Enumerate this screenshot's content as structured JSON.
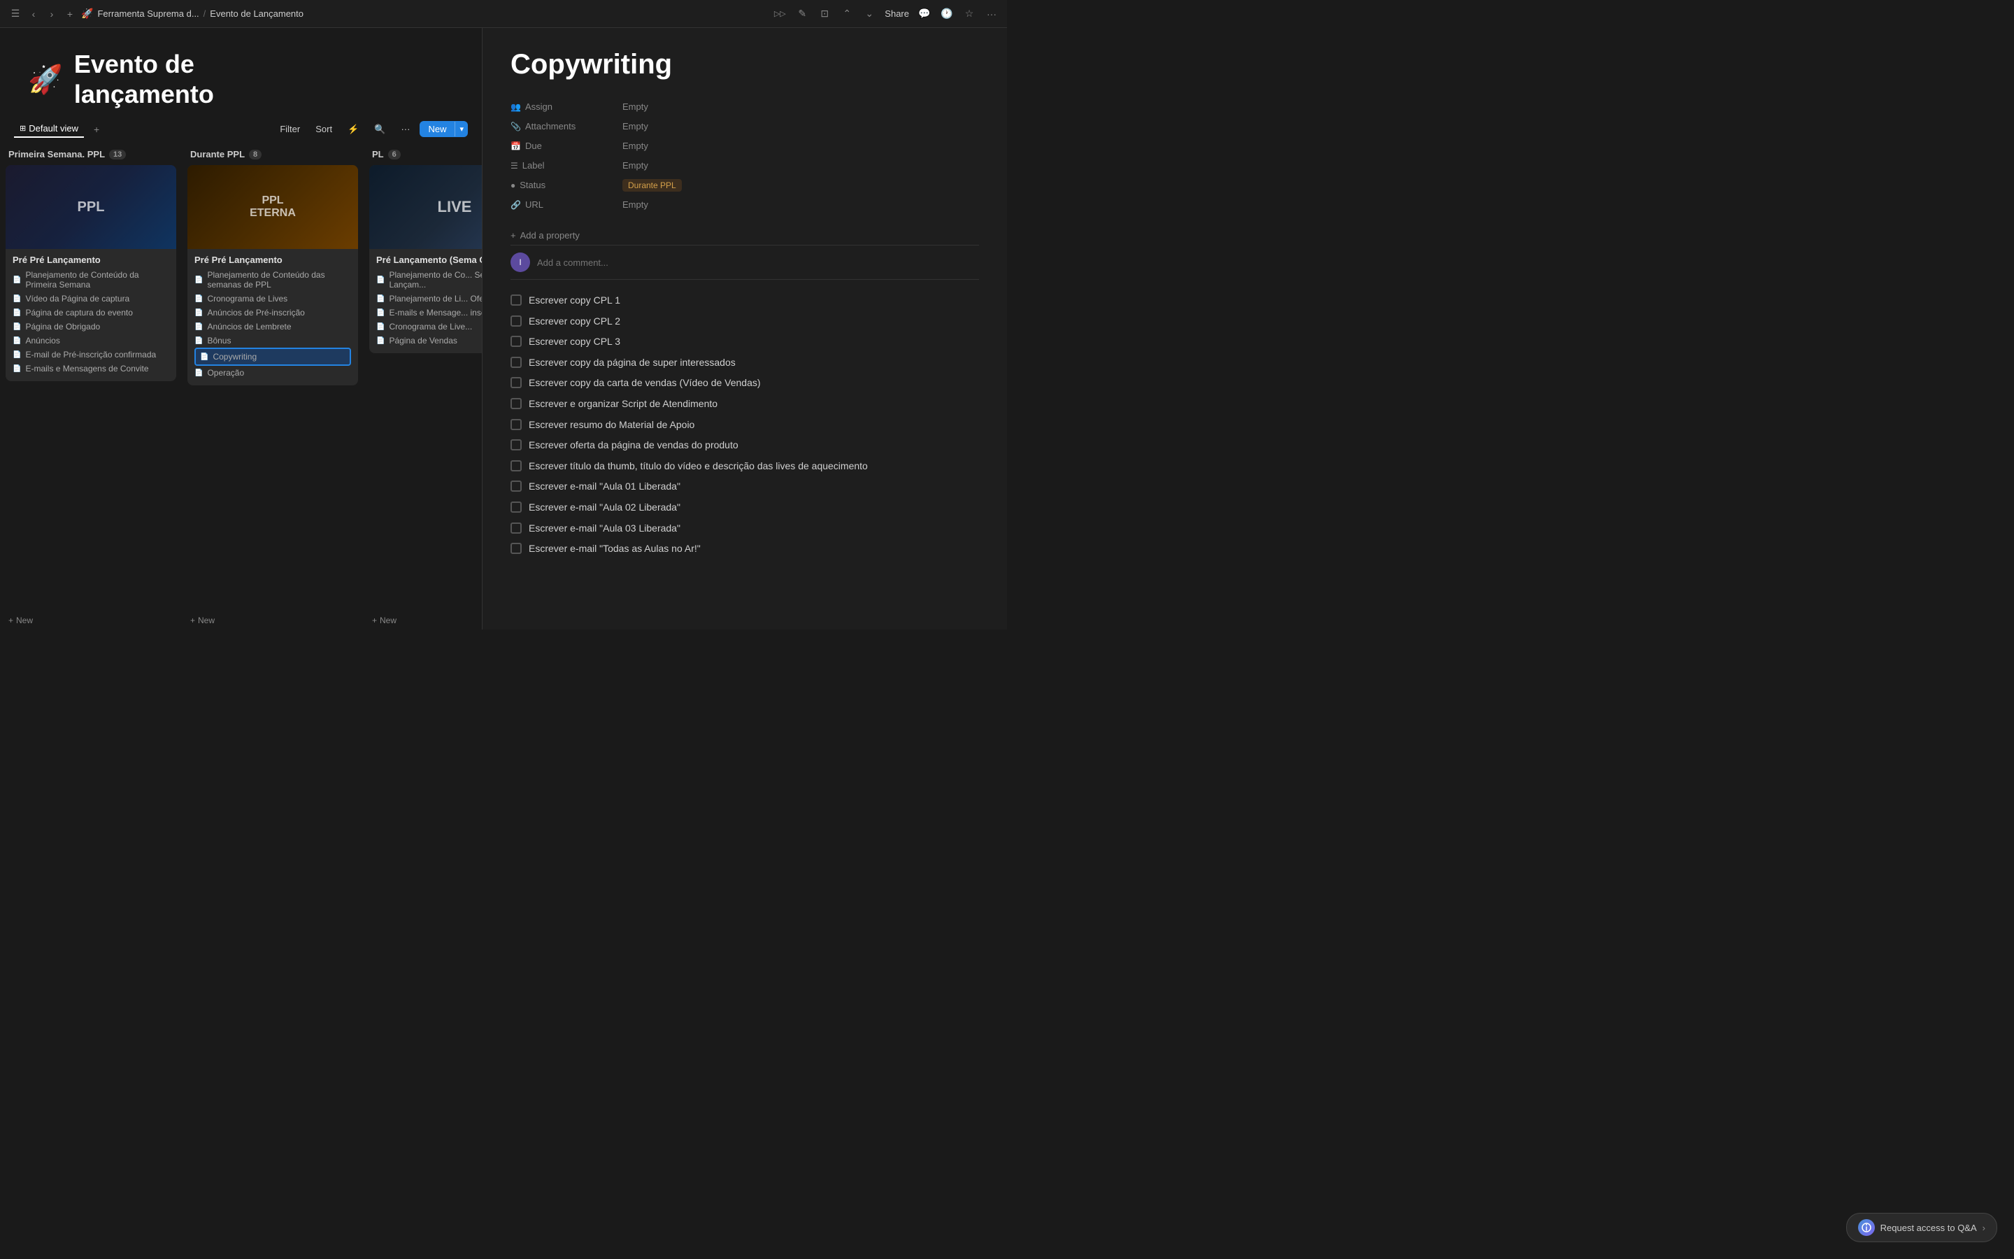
{
  "topbar": {
    "menu_icon": "☰",
    "back_icon": "‹",
    "forward_icon": "›",
    "add_icon": "+",
    "breadcrumb": [
      {
        "label": "Ferramenta Suprema d...",
        "has_icon": true
      },
      {
        "label": "Evento de Lançamento"
      }
    ],
    "right_actions": [
      "Share",
      "💬",
      "🕐",
      "☆",
      "···"
    ],
    "panel_icon": "▷▷"
  },
  "page": {
    "icon": "🚀",
    "title": "Evento de\nlançamento"
  },
  "toolbar": {
    "views": [
      {
        "label": "Default view",
        "icon": "⊞",
        "active": true
      }
    ],
    "add_view_label": "+",
    "filter_label": "Filter",
    "sort_label": "Sort",
    "lightning_icon": "⚡",
    "search_icon": "🔍",
    "more_icon": "···",
    "new_button_label": "New",
    "new_button_arrow": "▾"
  },
  "columns": [
    {
      "id": "col1",
      "label": "Primeira Semana. PPL",
      "count": 13,
      "cards": [
        {
          "id": "card1",
          "has_image": true,
          "image_style": "card-image-1",
          "image_text": "PPL",
          "title": "Pré Pré Lançamento",
          "items": [
            {
              "icon": "📄",
              "label": "Planejamento de Conteúdo da Primeira Semana"
            },
            {
              "icon": "📄",
              "label": "Vídeo da Página de captura"
            },
            {
              "icon": "📄",
              "label": "Página de captura do evento"
            },
            {
              "icon": "📄",
              "label": "Página de Obrigado"
            },
            {
              "icon": "📄",
              "label": "Anúncios"
            },
            {
              "icon": "📄",
              "label": "E-mail de Pré-inscrição confirmada"
            },
            {
              "icon": "📄",
              "label": "E-mails e Mensagens de Convite"
            }
          ]
        }
      ],
      "add_label": "New"
    },
    {
      "id": "col2",
      "label": "Durante PPL",
      "count": 8,
      "cards": [
        {
          "id": "card2",
          "has_image": true,
          "image_style": "card-image-2",
          "image_text": "PPL ETERNA",
          "title": "Pré Pré Lançamento",
          "items": [
            {
              "icon": "📄",
              "label": "Planejamento de Conteúdo das semanas de PPL"
            },
            {
              "icon": "📄",
              "label": "Cronograma de Lives"
            },
            {
              "icon": "📄",
              "label": "Anúncios de Pré-inscrição"
            },
            {
              "icon": "📄",
              "label": "Anúncios de Lembrete"
            },
            {
              "icon": "📄",
              "label": "Bônus"
            },
            {
              "icon": "📄",
              "label": "Copywriting",
              "active": true
            }
          ],
          "has_operacao": true
        }
      ],
      "add_label": "New"
    },
    {
      "id": "col3",
      "label": "PL",
      "count": 6,
      "cards": [
        {
          "id": "card3",
          "has_image": true,
          "image_style": "card-image-3",
          "image_text": "LIVE",
          "title": "Pré Lançamento (Sema CPL's)",
          "items": [
            {
              "icon": "📄",
              "label": "Planejamento de Co... Semana de Lançam..."
            },
            {
              "icon": "📄",
              "label": "Planejamento de Li... Oferta"
            },
            {
              "icon": "📄",
              "label": "E-mails e Mensage... inscrição"
            },
            {
              "icon": "📄",
              "label": "Cronograma de Live..."
            },
            {
              "icon": "📄",
              "label": "Página de Vendas"
            }
          ]
        }
      ],
      "add_label": "New"
    }
  ],
  "detail": {
    "title": "Copywriting",
    "properties": [
      {
        "icon": "👥",
        "label": "Assign",
        "value": "Empty"
      },
      {
        "icon": "📎",
        "label": "Attachments",
        "value": "Empty"
      },
      {
        "icon": "📅",
        "label": "Due",
        "value": "Empty"
      },
      {
        "icon": "☰",
        "label": "Label",
        "value": "Empty"
      },
      {
        "icon": "●",
        "label": "Status",
        "value": "Durante PPL",
        "is_status": true
      },
      {
        "icon": "🔗",
        "label": "URL",
        "value": "Empty"
      }
    ],
    "add_property_label": "Add a property",
    "comment_placeholder": "Add a comment...",
    "checklist": [
      {
        "text": "Escrever copy CPL 1",
        "checked": false
      },
      {
        "text": "Escrever copy CPL 2",
        "checked": false
      },
      {
        "text": "Escrever copy CPL 3",
        "checked": false
      },
      {
        "text": "Escrever copy da página de super interessados",
        "checked": false
      },
      {
        "text": "Escrever copy da carta de vendas (Vídeo de Vendas)",
        "checked": false
      },
      {
        "text": "Escrever e organizar Script de Atendimento",
        "checked": false
      },
      {
        "text": "Escrever resumo do Material de Apoio",
        "checked": false
      },
      {
        "text": "Escrever oferta da página de vendas do produto",
        "checked": false
      },
      {
        "text": "Escrever título da thumb, título do vídeo e descrição das lives de aquecimento",
        "checked": false
      },
      {
        "text": "Escrever e-mail \"Aula 01 Liberada\"",
        "checked": false
      },
      {
        "text": "Escrever e-mail \"Aula 02 Liberada\"",
        "checked": false
      },
      {
        "text": "Escrever e-mail \"Aula 03 Liberada\"",
        "checked": false
      },
      {
        "text": "Escrever e-mail \"Todas as Aulas no Ar!\"",
        "checked": false
      }
    ]
  },
  "qa": {
    "label": "Request access to Q&A",
    "arrow": "›"
  }
}
